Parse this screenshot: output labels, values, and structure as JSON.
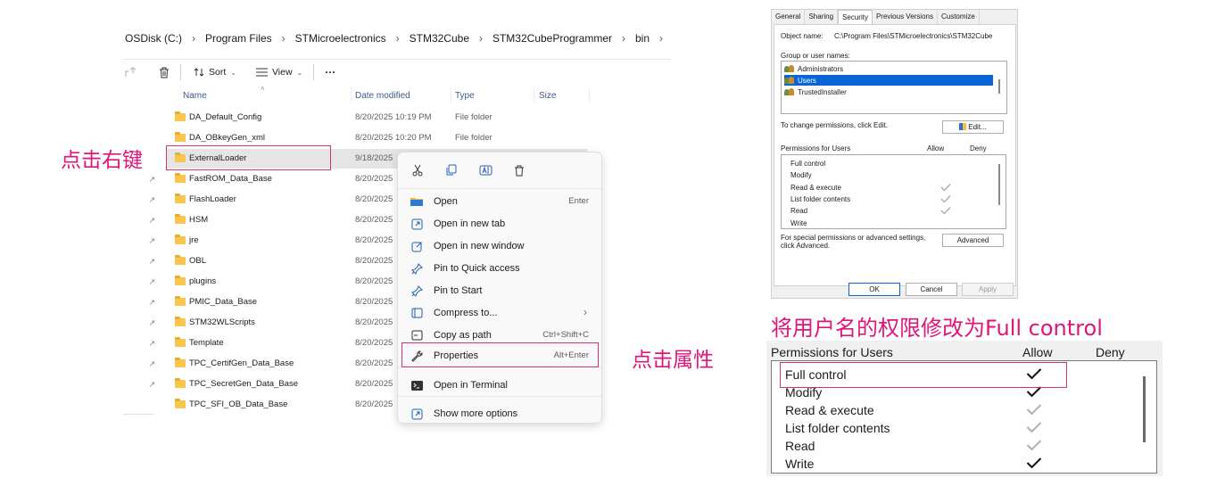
{
  "explorer": {
    "breadcrumb": [
      "OSDisk (C:)",
      "Program Files",
      "STMicroelectronics",
      "STM32Cube",
      "STM32CubeProgrammer",
      "bin"
    ],
    "toolbar": {
      "sort_label": "Sort",
      "view_label": "View",
      "more_label": "···"
    },
    "columns": {
      "name": "Name",
      "date": "Date modified",
      "type": "Type",
      "size": "Size"
    },
    "rows": [
      {
        "name": "DA_Default_Config",
        "date": "8/20/2025 10:19 PM",
        "type": "File folder"
      },
      {
        "name": "DA_OBkeyGen_xml",
        "date": "8/20/2025 10:20 PM",
        "type": "File folder"
      },
      {
        "name": "ExternalLoader",
        "date": "9/18/2025 ",
        "type": ""
      },
      {
        "name": "FastROM_Data_Base",
        "date": "8/20/2025 ",
        "type": ""
      },
      {
        "name": "FlashLoader",
        "date": "8/20/2025 ",
        "type": ""
      },
      {
        "name": "HSM",
        "date": "8/20/2025 ",
        "type": ""
      },
      {
        "name": "jre",
        "date": "8/20/2025 ",
        "type": ""
      },
      {
        "name": "OBL",
        "date": "8/20/2025 ",
        "type": ""
      },
      {
        "name": "plugins",
        "date": "8/20/2025 ",
        "type": ""
      },
      {
        "name": "PMIC_Data_Base",
        "date": "8/20/2025 ",
        "type": ""
      },
      {
        "name": "STM32WLScripts",
        "date": "8/20/2025 ",
        "type": ""
      },
      {
        "name": "Template",
        "date": "8/20/2025 ",
        "type": ""
      },
      {
        "name": "TPC_CertifGen_Data_Base",
        "date": "8/20/2025 ",
        "type": ""
      },
      {
        "name": "TPC_SecretGen_Data_Base",
        "date": "8/20/2025 ",
        "type": ""
      },
      {
        "name": "TPC_SFI_OB_Data_Base",
        "date": "8/20/2025 ",
        "type": ""
      }
    ]
  },
  "context_menu": {
    "items": [
      {
        "label": "Open",
        "shortcut": "Enter",
        "icon": "folder-icon"
      },
      {
        "label": "Open in new tab",
        "shortcut": "",
        "icon": "new-tab-icon"
      },
      {
        "label": "Open in new window",
        "shortcut": "",
        "icon": "new-window-icon"
      },
      {
        "label": "Pin to Quick access",
        "shortcut": "",
        "icon": "pin-icon"
      },
      {
        "label": "Pin to Start",
        "shortcut": "",
        "icon": "pin-icon"
      },
      {
        "label": "Compress to...",
        "shortcut": "",
        "icon": "archive-icon"
      },
      {
        "label": "Copy as path",
        "shortcut": "Ctrl+Shift+C",
        "icon": "copy-path-icon"
      },
      {
        "label": "Properties",
        "shortcut": "Alt+Enter",
        "icon": "wrench-icon"
      },
      {
        "label": "Open in Terminal",
        "shortcut": "",
        "icon": "terminal-icon"
      },
      {
        "label": "Show more options",
        "shortcut": "",
        "icon": "more-options-icon"
      }
    ]
  },
  "annotations": {
    "right_click": "点击右键",
    "click_properties": "点击属性",
    "change_permission": "将用户名的权限修改为Full control"
  },
  "properties_dialog": {
    "tabs": [
      "General",
      "Sharing",
      "Security",
      "Previous Versions",
      "Customize"
    ],
    "active_tab": "Security",
    "object_name_label": "Object name:",
    "object_name_value": "C:\\Program Files\\STMicroelectronics\\STM32Cube",
    "group_label": "Group or user names:",
    "groups": [
      "Administrators",
      "Users",
      "TrustedInstaller"
    ],
    "selected_group": "Users",
    "change_hint": "To change permissions, click Edit.",
    "edit_button": "Edit...",
    "permissions_label": "Permissions for Users",
    "allow_label": "Allow",
    "deny_label": "Deny",
    "permissions": [
      {
        "name": "Full control",
        "allow": false
      },
      {
        "name": "Modify",
        "allow": false
      },
      {
        "name": "Read & execute",
        "allow": true
      },
      {
        "name": "List folder contents",
        "allow": true
      },
      {
        "name": "Read",
        "allow": true
      },
      {
        "name": "Write",
        "allow": false
      }
    ],
    "special_hint_1": "For special permissions or advanced settings,",
    "special_hint_2": "click Advanced.",
    "advanced_button": "Advanced",
    "ok_button": "OK",
    "cancel_button": "Cancel",
    "apply_button": "Apply"
  },
  "zoomed_permissions": {
    "title": "Permissions for Users",
    "allow_label": "Allow",
    "deny_label": "Deny",
    "rows": [
      {
        "name": "Full control",
        "allow": "checked"
      },
      {
        "name": "Modify",
        "allow": "checked"
      },
      {
        "name": "Read & execute",
        "allow": "grey"
      },
      {
        "name": "List folder contents",
        "allow": "grey"
      },
      {
        "name": "Read",
        "allow": "grey"
      },
      {
        "name": "Write",
        "allow": "checked"
      }
    ]
  },
  "colors": {
    "annotation": "#e0147a",
    "selection": "#0a64d6"
  }
}
